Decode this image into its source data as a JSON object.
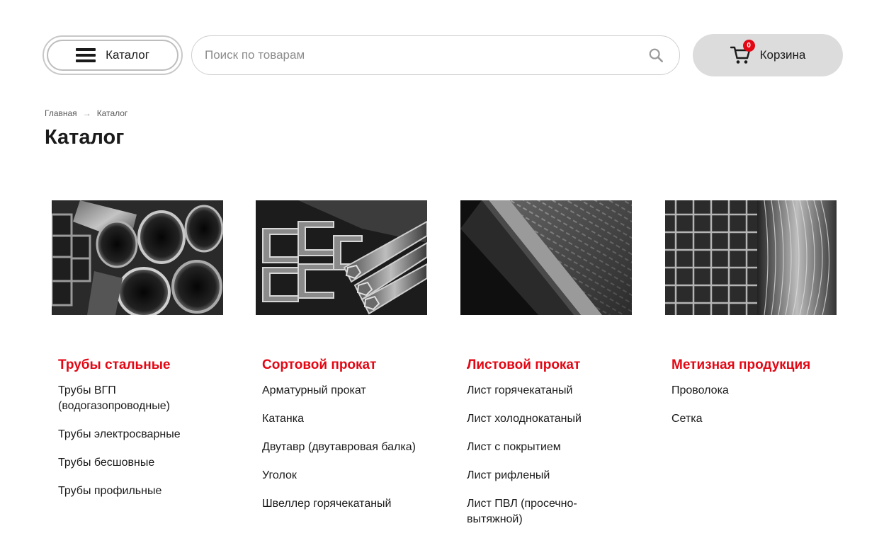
{
  "header": {
    "catalog_label": "Каталог",
    "search_placeholder": "Поиск по товарам",
    "cart_label": "Корзина",
    "cart_count": "0"
  },
  "breadcrumb": {
    "items": [
      "Главная",
      "Каталог"
    ],
    "separator": "→"
  },
  "page": {
    "title": "Каталог"
  },
  "categories": [
    {
      "title": "Трубы стальные",
      "items": [
        "Трубы ВГП (водогазопроводные)",
        "Трубы электросварные",
        "Трубы бесшовные",
        "Трубы профильные"
      ]
    },
    {
      "title": "Сортовой прокат",
      "items": [
        "Арматурный прокат",
        "Катанка",
        "Двутавр (двутавровая балка)",
        "Уголок",
        "Швеллер горячекатаный"
      ]
    },
    {
      "title": "Листовой прокат",
      "items": [
        "Лист горячекатаный",
        "Лист холоднокатаный",
        "Лист с покрытием",
        "Лист рифленый",
        "Лист ПВЛ (просечно-вытяжной)"
      ]
    },
    {
      "title": "Метизная продукция",
      "items": [
        "Проволока",
        "Сетка"
      ]
    }
  ],
  "colors": {
    "accent": "#e30613",
    "cart_bg": "#dcdcdc",
    "text": "#1a1a1a"
  },
  "icons": {
    "menu": "menu-icon",
    "search": "search-icon",
    "cart": "cart-icon"
  }
}
